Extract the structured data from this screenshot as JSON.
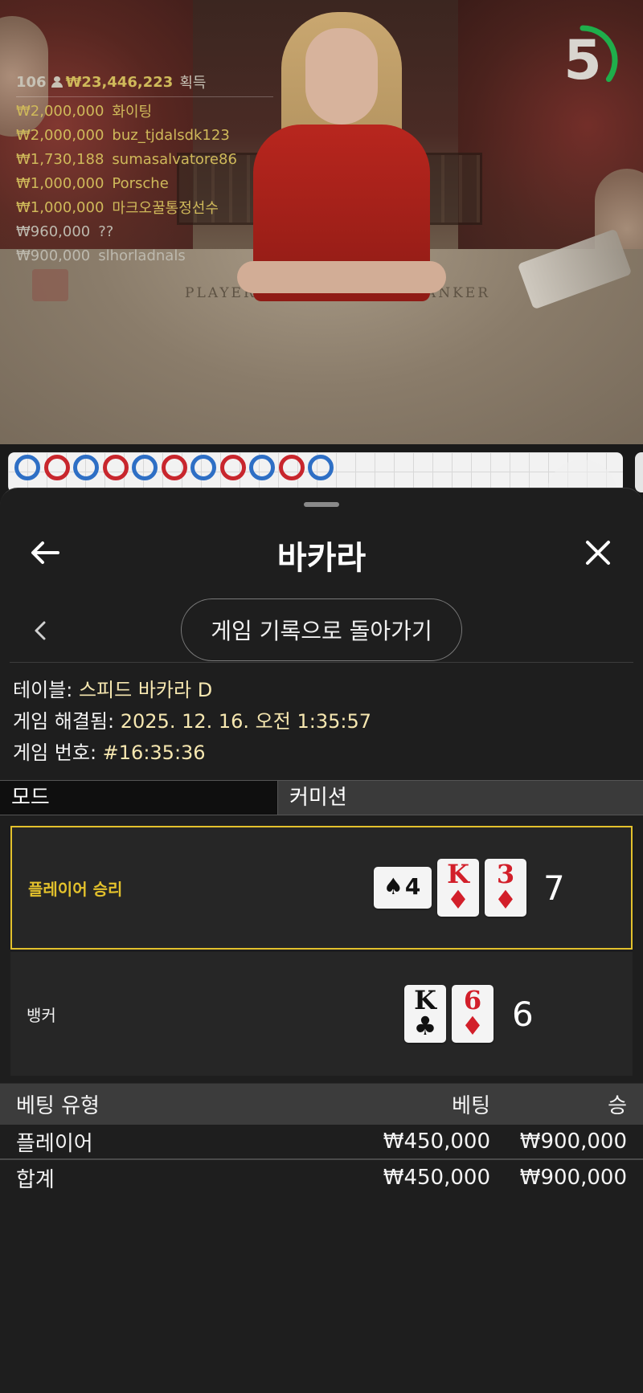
{
  "video": {
    "table_labels": [
      "PLAYER",
      "BANKER"
    ],
    "countdown": "5",
    "countdown_fraction": 0.35,
    "leaderboard": {
      "player_count": "106",
      "total_won": "₩23,446,223",
      "won_label": "획득",
      "entries": [
        {
          "amount": "₩2,000,000",
          "name": "화이팅"
        },
        {
          "amount": "₩2,000,000",
          "name": "buz_tjdalsdk123"
        },
        {
          "amount": "₩1,730,188",
          "name": "sumasalvatore86"
        },
        {
          "amount": "₩1,000,000",
          "name": "Porsche"
        },
        {
          "amount": "₩1,000,000",
          "name": "마크오꿀통정선수"
        },
        {
          "amount": "₩960,000",
          "name": "??"
        },
        {
          "amount": "₩900,000",
          "name": "slhorladnals"
        }
      ]
    }
  },
  "roadmap": {
    "colors": {
      "player": "#2e6fc5",
      "banker": "#c8262d"
    },
    "top_row": [
      "player",
      "banker",
      "player",
      "banker",
      "player",
      "banker",
      "player",
      "banker",
      "player",
      "banker",
      "player"
    ]
  },
  "sheet": {
    "title": "바카라",
    "back_to_history": "게임 기록으로 돌아가기",
    "info": {
      "table_label": "테이블: ",
      "table_value": "스피드 바카라 D",
      "resolved_label": "게임 해결됨: ",
      "resolved_value": "2025. 12. 16. 오전 1:35:57",
      "number_label": "게임 번호: ",
      "number_value": "#16:35:36"
    },
    "tabs": {
      "mode": "모드",
      "commission": "커미션"
    },
    "results": {
      "player": {
        "label": "플레이어 승리",
        "score": "7",
        "cards": [
          {
            "rank": "4",
            "suit": "♠",
            "color": "black",
            "sideways": true
          },
          {
            "rank": "K",
            "suit": "♦",
            "color": "red",
            "sideways": false
          },
          {
            "rank": "3",
            "suit": "♦",
            "color": "red",
            "sideways": false
          }
        ]
      },
      "banker": {
        "label": "뱅커",
        "score": "6",
        "cards": [
          {
            "rank": "K",
            "suit": "♣",
            "color": "black",
            "sideways": false
          },
          {
            "rank": "6",
            "suit": "♦",
            "color": "red",
            "sideways": false
          }
        ]
      }
    },
    "bets": {
      "headers": {
        "type": "베팅 유형",
        "bet": "베팅",
        "win": "승"
      },
      "rows": [
        {
          "type": "플레이어",
          "bet": "₩450,000",
          "win": "₩900,000"
        }
      ],
      "total": {
        "type": "합계",
        "bet": "₩450,000",
        "win": "₩900,000"
      }
    },
    "accent_color": "#e3c12c"
  }
}
